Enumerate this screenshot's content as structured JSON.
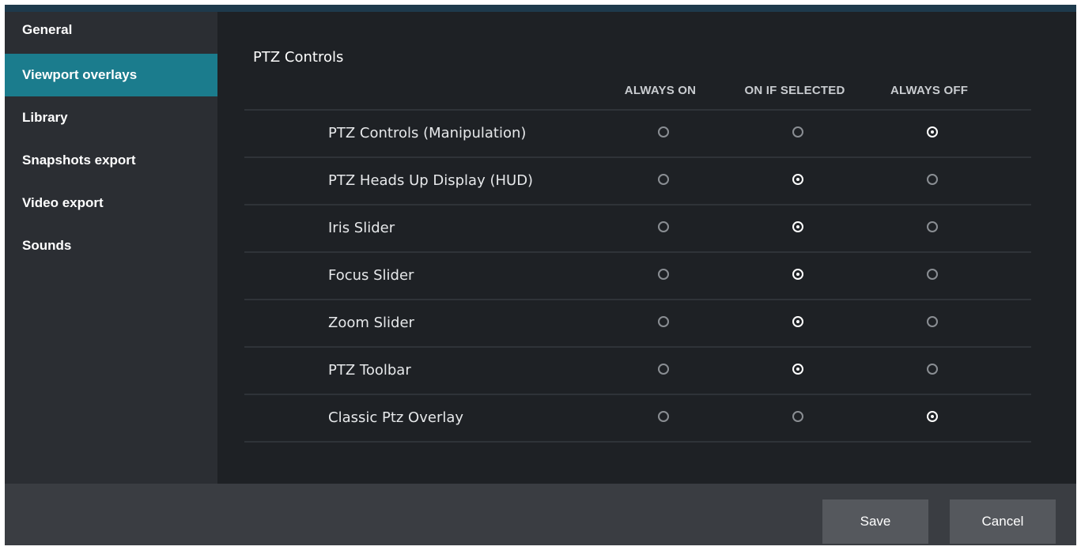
{
  "sidebar": {
    "items": [
      {
        "label": "General"
      },
      {
        "label": "Viewport overlays"
      },
      {
        "label": "Library"
      },
      {
        "label": "Snapshots export"
      },
      {
        "label": "Video export"
      },
      {
        "label": "Sounds"
      }
    ],
    "active_index": 1
  },
  "section": {
    "title": "PTZ Controls",
    "columns": [
      "ALWAYS ON",
      "ON IF SELECTED",
      "ALWAYS OFF"
    ],
    "rows": [
      {
        "label": "PTZ Controls (Manipulation)",
        "selected": "ALWAYS OFF"
      },
      {
        "label": "PTZ Heads Up Display (HUD)",
        "selected": "ON IF SELECTED"
      },
      {
        "label": "Iris Slider",
        "selected": "ON IF SELECTED"
      },
      {
        "label": "Focus Slider",
        "selected": "ON IF SELECTED"
      },
      {
        "label": "Zoom Slider",
        "selected": "ON IF SELECTED"
      },
      {
        "label": "PTZ Toolbar",
        "selected": "ON IF SELECTED"
      },
      {
        "label": "Classic Ptz Overlay",
        "selected": "ALWAYS OFF"
      }
    ]
  },
  "footer": {
    "save_label": "Save",
    "cancel_label": "Cancel"
  },
  "colors": {
    "accent": "#1b7c8d",
    "background": "#1e2125",
    "sidebar": "#2b2e33",
    "footer": "#3a3d42",
    "button": "#55585d"
  }
}
